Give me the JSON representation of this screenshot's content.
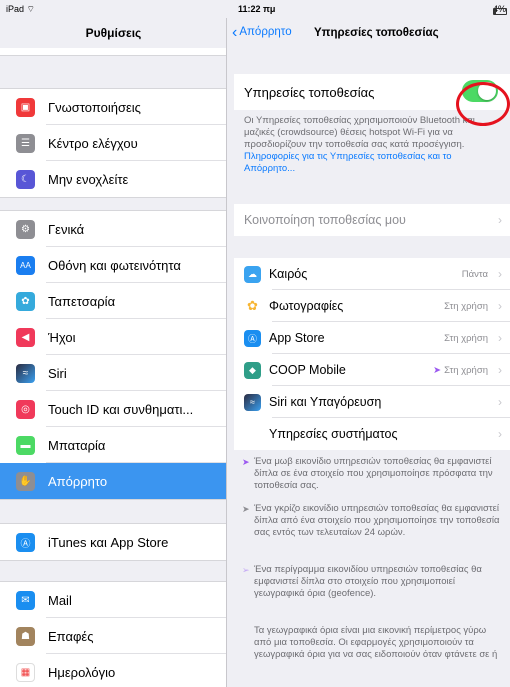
{
  "status_bar": {
    "device": "iPad",
    "wifi_icon": "wifi-icon",
    "time": "11:22 πμ",
    "battery": "4%"
  },
  "left": {
    "title": "Ρυθμίσεις",
    "groups": [
      [
        {
          "label": "Γνωστοποιήσεις",
          "icon": "notifications-icon",
          "color": "#f0393a"
        },
        {
          "label": "Κέντρο ελέγχου",
          "icon": "control-center-icon",
          "color": "#8e8e93"
        },
        {
          "label": "Μην ενοχλείτε",
          "icon": "moon-icon",
          "color": "#5856d6"
        }
      ],
      [
        {
          "label": "Γενικά",
          "icon": "gear-icon",
          "color": "#8e8e93"
        },
        {
          "label": "Οθόνη και φωτεινότητα",
          "icon": "display-icon",
          "color": "#1a7ef0"
        },
        {
          "label": "Ταπετσαρία",
          "icon": "wallpaper-icon",
          "color": "#35aadc"
        },
        {
          "label": "Ήχοι",
          "icon": "speaker-icon",
          "color": "#f0395a"
        },
        {
          "label": "Siri",
          "icon": "siri-icon",
          "color": "#2b2b40"
        },
        {
          "label": "Touch ID και συνθηματι...",
          "icon": "fingerprint-icon",
          "color": "#f0395a"
        },
        {
          "label": "Μπαταρία",
          "icon": "battery-icon",
          "color": "#4cd964"
        },
        {
          "label": "Απόρρητο",
          "icon": "hand-icon",
          "color": "#8e8e93",
          "active": true
        }
      ],
      [
        {
          "label": "iTunes και App Store",
          "icon": "app-store-icon",
          "color": "#1a8ef0"
        }
      ],
      [
        {
          "label": "Mail",
          "icon": "mail-icon",
          "color": "#1a8ef0"
        },
        {
          "label": "Επαφές",
          "icon": "contacts-icon",
          "color": "#a2845e"
        },
        {
          "label": "Ημερολόγιο",
          "icon": "calendar-icon",
          "color": "#ffffff"
        }
      ]
    ]
  },
  "right": {
    "back_label": "Απόρρητο",
    "title": "Υπηρεσίες τοποθεσίας",
    "location_toggle": {
      "label": "Υπηρεσίες τοποθεσίας",
      "on": true
    },
    "description": "Οι Υπηρεσίες τοποθεσίας χρησιμοποιούν Bluetooth και μαζικές (crowdsource) θέσεις hotspot Wi-Fi για να προσδιορίζουν την τοποθεσία σας κατά προσέγγιση.",
    "description_link": "Πληροφορίες για τις Υπηρεσίες τοποθεσίας και το Απόρρητο...",
    "share_location": "Κοινοποίηση τοποθεσίας μου",
    "apps": [
      {
        "label": "Καιρός",
        "value": "Πάντα",
        "icon": "weather-icon",
        "color": "#3aa3f0"
      },
      {
        "label": "Φωτογραφίες",
        "value": "Στη χρήση",
        "icon": "photos-icon",
        "color": "#f7b533"
      },
      {
        "label": "App Store",
        "value": "Στη χρήση",
        "icon": "app-store-icon",
        "color": "#1a8ef0"
      },
      {
        "label": "COOP Mobile",
        "value": "Στη χρήση",
        "icon": "coop-icon",
        "color": "#2f9e88",
        "arrow": true
      },
      {
        "label": "Siri και Υπαγόρευση",
        "value": "",
        "icon": "siri-icon",
        "color": "#2b2b40"
      },
      {
        "label": "Υπηρεσίες συστήματος",
        "value": "",
        "icon": "",
        "color": ""
      }
    ],
    "notes": [
      "Ένα μωβ εικονίδιο υπηρεσιών τοποθεσίας θα εμφανιστεί δίπλα σε ένα στοιχείο που χρησιμοποίησε πρόσφατα την τοποθεσία σας.",
      "Ένα γκρίζο εικονίδιο υπηρεσιών τοποθεσίας θα εμφανιστεί δίπλα από ένα στοιχείο που χρησιμοποίησε την τοποθεσία σας εντός των τελευταίων 24 ωρών.",
      "Ένα περίγραμμα εικονιδίου υπηρεσιών τοποθεσίας θα εμφανιστεί δίπλα στο στοιχείο που χρησιμοποιεί γεωγραφικά όρια (geofence).",
      "Τα γεωγραφικά όρια είναι μια εικονική περίμετρος γύρω από μια τοποθεσία. Οι εφαρμογές χρησιμοποιούν τα γεωγραφικά όρια για να σας ειδοποιούν όταν φτάνετε σε ή"
    ]
  }
}
